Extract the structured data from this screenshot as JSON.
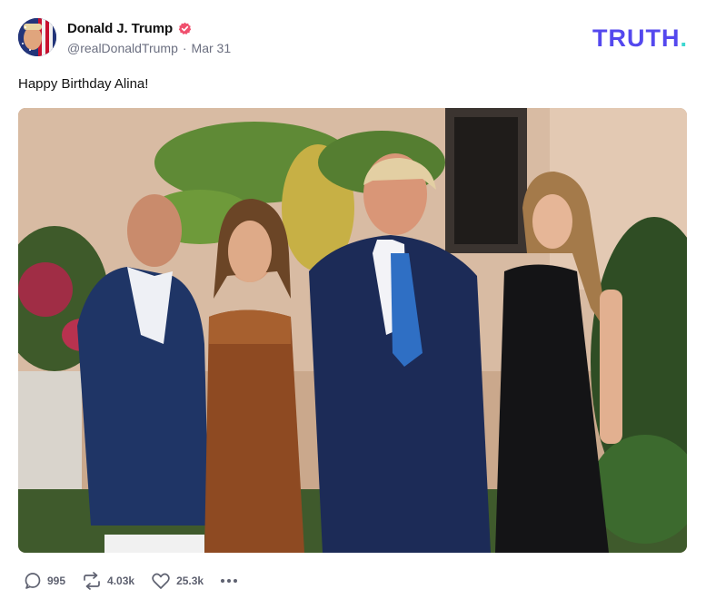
{
  "post": {
    "author": {
      "display_name": "Donald J. Trump",
      "handle": "@realDonaldTrump",
      "date": "Mar 31",
      "verified": true,
      "avatar": "avatar-image"
    },
    "text": "Happy Birthday Alina!",
    "media": {
      "type": "photo",
      "description": "photo-image"
    },
    "actions": {
      "replies": "995",
      "retruths": "4.03k",
      "likes": "25.3k"
    }
  },
  "brand": {
    "logo_text": "TRUTH",
    "logo_dot": ".",
    "logo_color": "#5448ee",
    "dot_color": "#3cd7d0"
  },
  "colors": {
    "verified": "#f0506e",
    "action_icon": "#5e6170"
  },
  "icons": {
    "verified": "verified-badge-icon",
    "reply": "reply-icon",
    "retruth": "retruth-icon",
    "like": "heart-icon",
    "more": "more-icon"
  }
}
